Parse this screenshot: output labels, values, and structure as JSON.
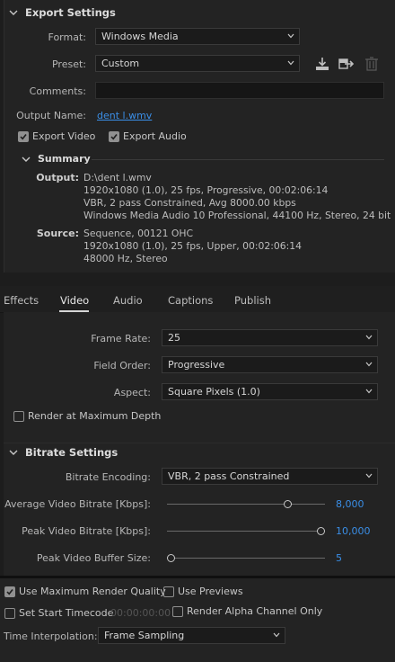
{
  "export_settings": {
    "title": "Export Settings",
    "format_label": "Format:",
    "format_value": "Windows Media",
    "preset_label": "Preset:",
    "preset_value": "Custom",
    "comments_label": "Comments:",
    "comments_value": "",
    "output_name_label": "Output Name:",
    "output_name_value": "dent l.wmv",
    "export_video_label": "Export Video",
    "export_video_checked": true,
    "export_audio_label": "Export Audio",
    "export_audio_checked": true
  },
  "summary": {
    "title": "Summary",
    "output_key": "Output:",
    "output_lines": [
      "D:\\dent l.wmv",
      "1920x1080 (1.0), 25 fps, Progressive, 00:02:06:14",
      "VBR, 2 pass Constrained, Avg 8000.00 kbps",
      "Windows Media Audio 10 Professional, 44100 Hz, Stereo, 24 bit"
    ],
    "source_key": "Source:",
    "source_lines": [
      "Sequence, 00121 OHC",
      "1920x1080 (1.0), 25 fps, Upper, 00:02:06:14",
      "48000 Hz, Stereo"
    ]
  },
  "tabs": [
    "Effects",
    "Video",
    "Audio",
    "Captions",
    "Publish"
  ],
  "active_tab": "Video",
  "video": {
    "frame_rate_label": "Frame Rate:",
    "frame_rate_value": "25",
    "field_order_label": "Field Order:",
    "field_order_value": "Progressive",
    "aspect_label": "Aspect:",
    "aspect_value": "Square Pixels (1.0)",
    "render_max_depth_label": "Render at Maximum Depth",
    "render_max_depth_checked": false
  },
  "bitrate": {
    "title": "Bitrate Settings",
    "encoding_label": "Bitrate Encoding:",
    "encoding_value": "VBR, 2 pass Constrained",
    "avg_label": "Average Video Bitrate [Kbps]:",
    "avg_value": "8,000",
    "avg_fraction": 0.78,
    "peak_label": "Peak Video Bitrate [Kbps]:",
    "peak_value": "10,000",
    "peak_fraction": 1.0,
    "buffer_label": "Peak Video Buffer Size:",
    "buffer_value": "5",
    "buffer_fraction": 0.0
  },
  "bottom": {
    "max_render_quality_label": "Use Maximum Render Quality",
    "max_render_quality_checked": true,
    "use_previews_label": "Use Previews",
    "use_previews_checked": false,
    "start_timecode_label": "Set Start Timecode",
    "start_timecode_checked": false,
    "start_timecode_value": "00:00:00:00",
    "alpha_only_label": "Render Alpha Channel Only",
    "alpha_only_checked": false,
    "time_interp_label": "Time Interpolation:",
    "time_interp_value": "Frame Sampling"
  },
  "colors": {
    "accent_link": "#3b8fe8",
    "value_blue": "#3a8ee6",
    "background": "#232323"
  },
  "icons": [
    "chevron-down-icon",
    "save-preset-icon",
    "import-preset-icon",
    "delete-preset-icon",
    "checkmark-icon"
  ]
}
